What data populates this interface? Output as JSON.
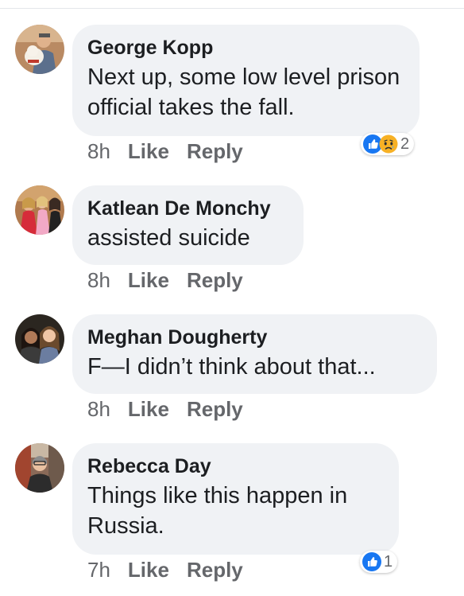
{
  "comments": [
    {
      "author": "George Kopp",
      "text": "Next up, some low level prison official takes the fall.",
      "time": "8h",
      "like_label": "Like",
      "reply_label": "Reply",
      "reactions": {
        "types": [
          "like-icon",
          "sad-icon"
        ],
        "count": "2"
      }
    },
    {
      "author": "Katlean De Monchy",
      "text": "assisted suicide",
      "time": "8h",
      "like_label": "Like",
      "reply_label": "Reply"
    },
    {
      "author": "Meghan Dougherty",
      "text": "F—I didn’t think about that...",
      "time": "8h",
      "like_label": "Like",
      "reply_label": "Reply"
    },
    {
      "author": "Rebecca Day",
      "text": "Things like this happen in Russia.",
      "time": "7h",
      "like_label": "Like",
      "reply_label": "Reply",
      "reactions": {
        "types": [
          "like-icon"
        ],
        "count": "1"
      }
    }
  ],
  "colors": {
    "bubble": "#f0f2f5",
    "text": "#1c1e21",
    "meta": "#65676b",
    "like_blue": "#1877f2",
    "sad_yellow": "#f7b125"
  }
}
